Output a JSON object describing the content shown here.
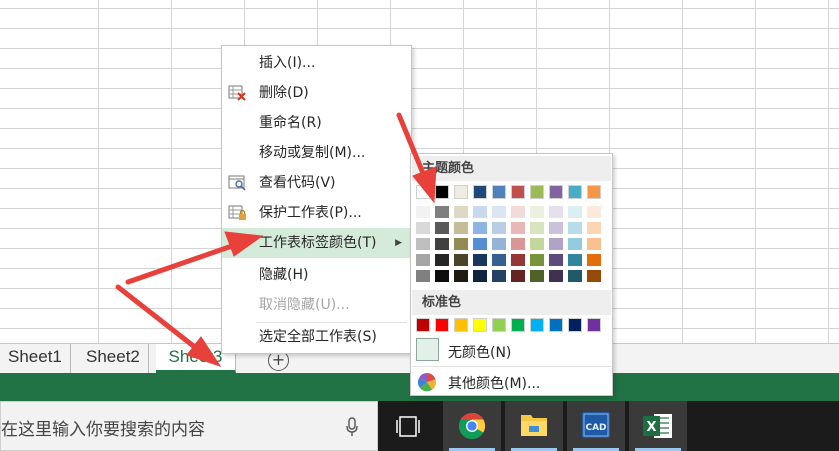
{
  "sheet_tabs": [
    "Sheet1",
    "Sheet2",
    "Sheet3"
  ],
  "add_sheet_symbol": "+",
  "context_menu": {
    "items": [
      {
        "label": "插入(I)...",
        "icon": ""
      },
      {
        "label": "删除(D)",
        "icon": "delete-sheet-icon"
      },
      {
        "label": "重命名(R)",
        "icon": ""
      },
      {
        "label": "移动或复制(M)...",
        "icon": ""
      },
      {
        "label": "查看代码(V)",
        "icon": "view-code-icon"
      },
      {
        "label": "保护工作表(P)...",
        "icon": "protect-sheet-icon"
      },
      {
        "label": "工作表标签颜色(T)",
        "icon": "",
        "submenu": true,
        "highlighted": true
      },
      {
        "label": "隐藏(H)",
        "icon": ""
      },
      {
        "label": "取消隐藏(U)...",
        "icon": "",
        "disabled": true
      },
      {
        "label": "选定全部工作表(S)",
        "icon": ""
      }
    ]
  },
  "color_picker": {
    "theme_label": "主题颜色",
    "standard_label": "标准色",
    "no_color_label": "无颜色(N)",
    "more_colors_label": "其他颜色(M)...",
    "theme_top": [
      "#FFFFFF",
      "#000000",
      "#EEECE1",
      "#1F497D",
      "#4F81BD",
      "#C0504D",
      "#9BBB59",
      "#8064A2",
      "#4BACC6",
      "#F79646"
    ],
    "theme_shades": [
      [
        "#F2F2F2",
        "#D9D9D9",
        "#BFBFBF",
        "#A6A6A6",
        "#808080"
      ],
      [
        "#7F7F7F",
        "#595959",
        "#404040",
        "#262626",
        "#0D0D0D"
      ],
      [
        "#DDD9C4",
        "#C4BD97",
        "#948A54",
        "#4A452A",
        "#1E1C11"
      ],
      [
        "#C6D9F1",
        "#8DB4E2",
        "#558ED5",
        "#17375E",
        "#0F243E"
      ],
      [
        "#DCE6F2",
        "#B9CDE5",
        "#95B3D7",
        "#366092",
        "#244062"
      ],
      [
        "#F2DCDB",
        "#E6B9B8",
        "#D99694",
        "#953735",
        "#632523"
      ],
      [
        "#EBF1DE",
        "#D7E4BD",
        "#C3D69B",
        "#77933C",
        "#4F6228"
      ],
      [
        "#E6E0EC",
        "#CCC1DA",
        "#B3A2C7",
        "#604A7B",
        "#403152"
      ],
      [
        "#DBEEF4",
        "#B7DEE8",
        "#93CDDD",
        "#31859C",
        "#215968"
      ],
      [
        "#FDEADA",
        "#FCD5B5",
        "#FAC090",
        "#E46C0A",
        "#984807"
      ]
    ],
    "standard": [
      "#C00000",
      "#FF0000",
      "#FFC000",
      "#FFFF00",
      "#92D050",
      "#00B050",
      "#00B0F0",
      "#0070C0",
      "#002060",
      "#7030A0"
    ]
  },
  "taskbar": {
    "search_placeholder": "在这里输入你要搜索的内容",
    "apps": [
      "task-view",
      "chrome",
      "file-explorer",
      "autocad",
      "excel"
    ],
    "excel_label": "X"
  },
  "colors": {
    "accent_green": "#217346",
    "menu_highlight": "#D5EBD9",
    "annotation_red": "#E8403A"
  }
}
